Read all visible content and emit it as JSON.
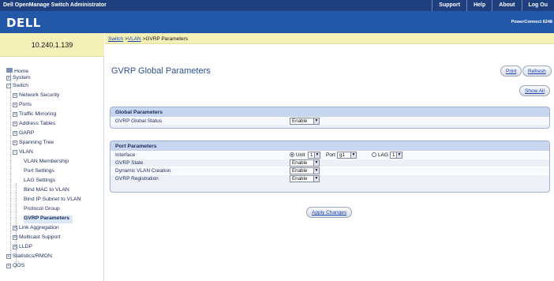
{
  "topbar": {
    "app_title": "Dell OpenManage Switch Administrator",
    "links": [
      "Support",
      "Help",
      "About",
      "Log Ou"
    ]
  },
  "brand": {
    "logo": "DELL",
    "model": "PowerConnect 6248"
  },
  "sidebar": {
    "ip": "10.240.1.139",
    "tree": [
      {
        "label": "Home",
        "exp": ""
      },
      {
        "label": "System",
        "exp": "+"
      },
      {
        "label": "Switch",
        "exp": "−"
      },
      {
        "label": "Network Security",
        "exp": "+"
      },
      {
        "label": "Ports",
        "exp": "+"
      },
      {
        "label": "Traffic Mirroring",
        "exp": "+"
      },
      {
        "label": "Address Tables",
        "exp": "+"
      },
      {
        "label": "GARP",
        "exp": "+"
      },
      {
        "label": "Spanning Tree",
        "exp": "+"
      },
      {
        "label": "VLAN",
        "exp": "−"
      },
      {
        "label": "VLAN Membership",
        "exp": ""
      },
      {
        "label": "Port Settings",
        "exp": ""
      },
      {
        "label": "LAG Settings",
        "exp": ""
      },
      {
        "label": "Bind MAC to VLAN",
        "exp": ""
      },
      {
        "label": "Bind IP Subnet to VLAN",
        "exp": ""
      },
      {
        "label": "Protocol Group",
        "exp": ""
      },
      {
        "label": "GVRP Parameters",
        "exp": ""
      },
      {
        "label": "Link Aggregation",
        "exp": "+"
      },
      {
        "label": "Multicast Support",
        "exp": "+"
      },
      {
        "label": "LLDP",
        "exp": "+"
      },
      {
        "label": "Statistics/RMON",
        "exp": "+"
      },
      {
        "label": "QOS",
        "exp": "+"
      }
    ]
  },
  "breadcrumb": {
    "switch": "Switch",
    "sep1": " >",
    "vlan": "VLAN",
    "current": " >GVRP Parameters"
  },
  "main": {
    "title": "GVRP Global Parameters",
    "print_label": "Print",
    "refresh_label": "Refresh",
    "show_all_label": "Show All",
    "apply_label": "Apply Changes"
  },
  "global_params": {
    "heading": "Global Parameters",
    "status_label": "GVRP Global Status",
    "status_value": "Enable"
  },
  "port_params": {
    "heading": "Port Parameters",
    "interface_label": "Interface",
    "unit_label": "Unit",
    "unit_value": "1",
    "port_label": "Port",
    "port_value": "g1",
    "lag_label": "LAG",
    "lag_value": "1",
    "gvrp_state_label": "GVRP State",
    "gvrp_state_value": "Enable",
    "dynamic_vlan_label": "Dynamic VLAN Creation",
    "dynamic_vlan_value": "Enable",
    "gvrp_reg_label": "GVRP Registration",
    "gvrp_reg_value": "Enable"
  },
  "colors": {
    "topbar": "#1e3f7e",
    "brand": "#2358a8",
    "panel_head": "#c7d5ee",
    "ip_strip": "#f4f1b8"
  }
}
